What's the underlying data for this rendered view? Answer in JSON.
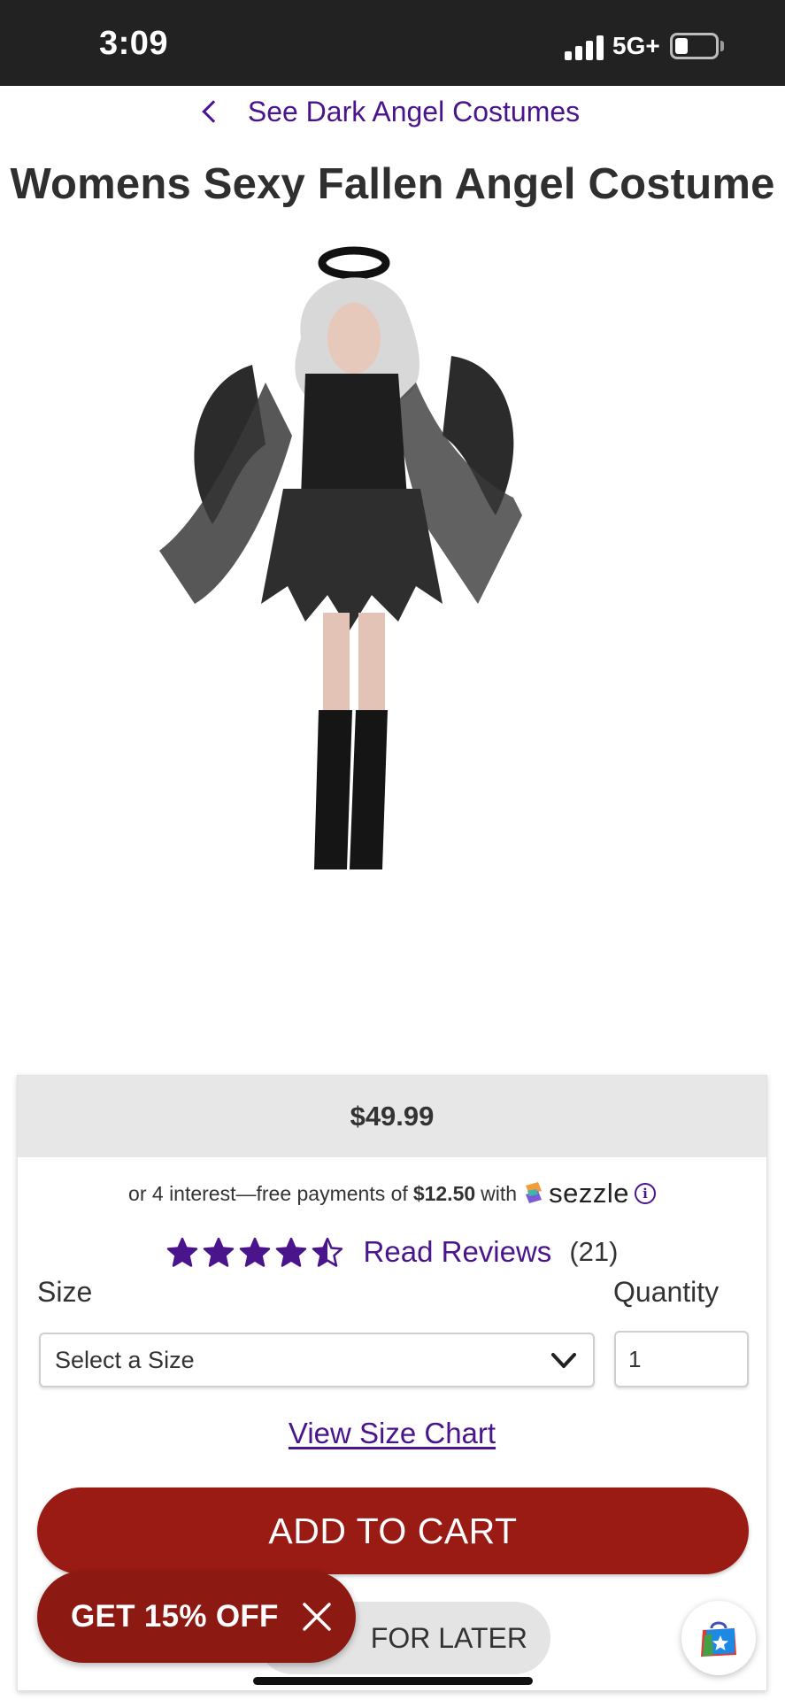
{
  "status_bar": {
    "time": "3:09",
    "network": "5G+"
  },
  "breadcrumb": {
    "label": "See Dark Angel Costumes"
  },
  "product": {
    "title": "Womens Sexy Fallen Angel Costume",
    "price": "$49.99"
  },
  "sezzle": {
    "prefix": "or 4 interest—free payments of",
    "amount": "$12.50",
    "with": "with",
    "brand": "sezzle"
  },
  "rating": {
    "stars": 4.5,
    "max": 5,
    "link_label": "Read Reviews",
    "count": "(21)"
  },
  "form": {
    "size_label": "Size",
    "size_value": "Select a Size",
    "quantity_label": "Quantity",
    "quantity_value": "1",
    "size_chart_link": "View Size Chart"
  },
  "actions": {
    "add_to_cart": "ADD TO CART",
    "save_for_later": "FOR LATER"
  },
  "promo": {
    "label": "GET 15% OFF"
  },
  "colors": {
    "accent_purple": "#4a148c",
    "cart_red": "#9a1b14",
    "promo_red": "#8c1a12",
    "status_bar": "#222222"
  },
  "icons": [
    "chevron-left-icon",
    "signal-icon",
    "battery-icon",
    "star-icon",
    "info-icon",
    "chevron-down-icon",
    "close-icon",
    "shopping-bag-icon"
  ]
}
